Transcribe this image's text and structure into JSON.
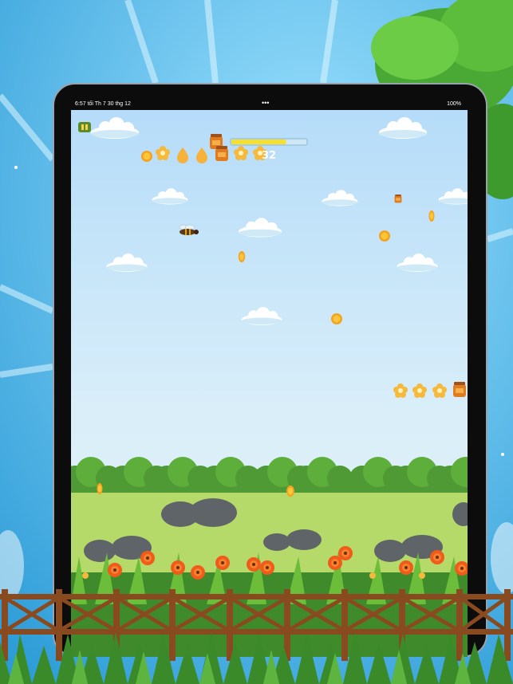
{
  "status_bar": {
    "time": "6:57 tối   Th 7 30 thg 12",
    "dots": "•••",
    "battery": "100%"
  },
  "hud": {
    "score": "32",
    "pause_icon": "pause-icon",
    "energy_fraction": 0.73
  },
  "colors": {
    "sky_top": "#b5dcf9",
    "grass": "#b5da6a",
    "coin": "#f7a21b",
    "bee_body": "#5b3a1a"
  }
}
